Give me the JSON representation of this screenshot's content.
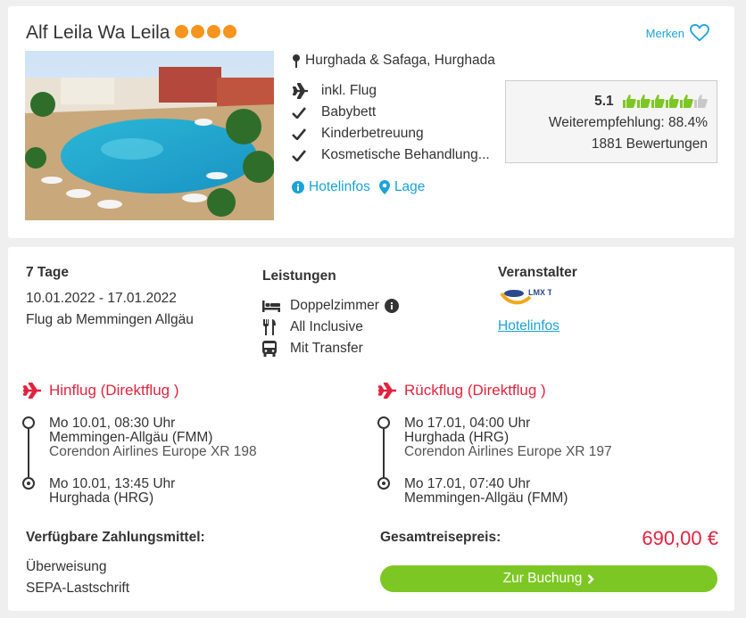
{
  "hotel": {
    "name": "Alf Leila Wa Leila",
    "stars": 4,
    "merken_label": "Merken",
    "location": "Hurghada & Safaga, Hurghada",
    "features": [
      "inkl. Flug",
      "Babybett",
      "Kinderbetreuung",
      "Kosmetische Behandlung..."
    ],
    "links": {
      "hotelinfos": "Hotelinfos",
      "lage": "Lage"
    },
    "rating": {
      "score": "5.1",
      "thumbs_filled": 5,
      "thumbs_total": 6,
      "recommendation": "Weiterempfehlung: 88.4%",
      "reviews": "1881 Bewertungen"
    }
  },
  "offer": {
    "duration": "7 Tage",
    "dates": "10.01.2022 - 17.01.2022",
    "departure": "Flug ab Memmingen Allgäu",
    "services_title": "Leistungen",
    "services": [
      "Doppelzimmer",
      "All Inclusive",
      "Mit Transfer"
    ],
    "operator_title": "Veranstalter",
    "operator_logo_text": "LMX Touristik",
    "operator_link": "Hotelinfos"
  },
  "outbound": {
    "title": "Hinflug (Direktflug )",
    "dep_time": "Mo 10.01, 08:30 Uhr",
    "dep_airport": "Memmingen-Allgäu (FMM)",
    "airline": "Corendon Airlines Europe XR 198",
    "arr_time": "Mo 10.01, 13:45 Uhr",
    "arr_airport": "Hurghada (HRG)"
  },
  "return": {
    "title": "Rückflug (Direktflug )",
    "dep_time": "Mo 17.01, 04:00 Uhr",
    "dep_airport": "Hurghada (HRG)",
    "airline": "Corendon Airlines Europe XR 197",
    "arr_time": "Mo 17.01, 07:40 Uhr",
    "arr_airport": "Memmingen-Allgäu (FMM)"
  },
  "payment": {
    "title": "Verfügbare Zahlungsmittel:",
    "methods": [
      "Überweisung",
      "SEPA-Lastschrift"
    ]
  },
  "total": {
    "label": "Gesamtreisepreis:",
    "price": "690,00 €",
    "button": "Zur Buchung"
  },
  "colors": {
    "accent_blue": "#1aa3d9",
    "star_orange": "#f7941d",
    "flight_red": "#e2233d",
    "cta_green": "#7dc724",
    "thumb_green": "#7dc724"
  }
}
